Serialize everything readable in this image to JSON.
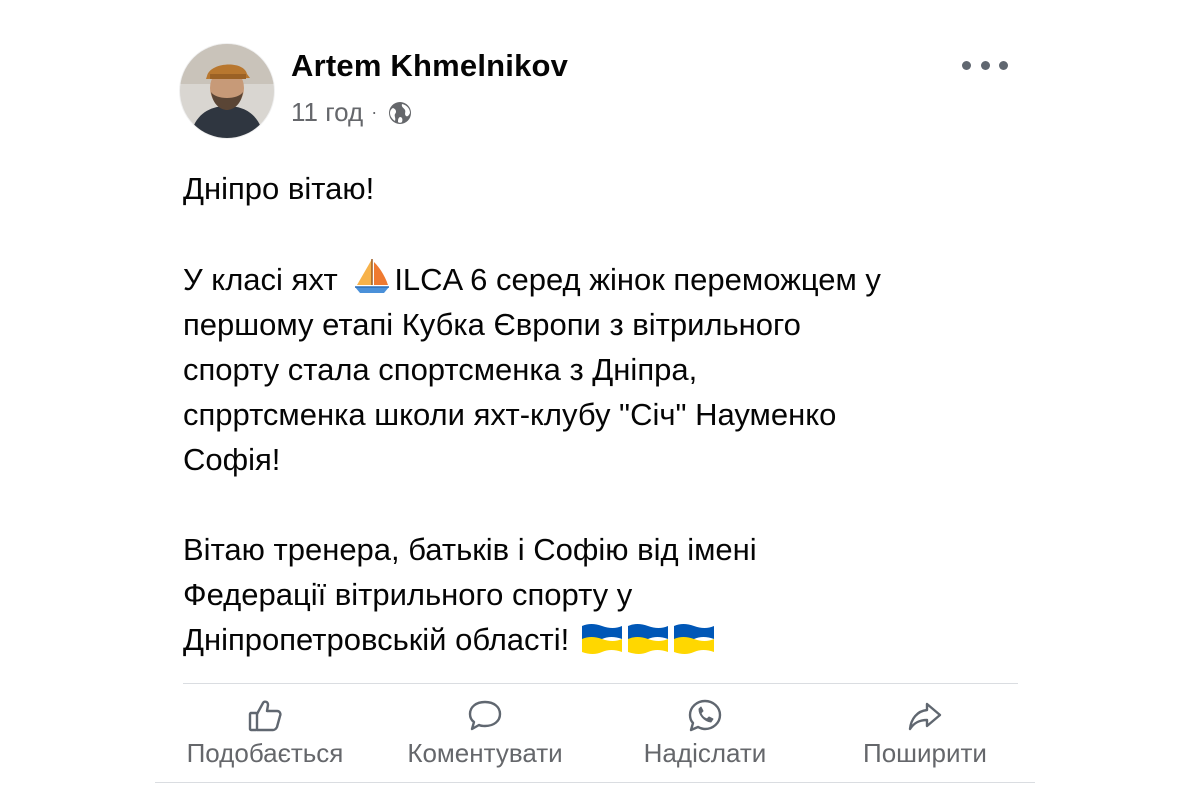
{
  "post": {
    "author": "Artem Khmelnikov",
    "time": "11 год",
    "separator": "·",
    "audience_icon": "globe-icon",
    "more_icon": "more-dots-icon",
    "text": {
      "greeting": "Дніпро вітаю!",
      "p2_line1_a": "У класі яхт",
      "p2_line1_b": "ILCA 6 серед жінок переможцем у",
      "p2_line2": "першому етапі Кубка Європи з вітрильного",
      "p2_line3": "спорту стала спортсменка з Дніпра,",
      "p2_line4": "спрртсменка  школи яхт-клубу \"Січ\" Науменко",
      "p2_line5": "Софія!",
      "p3_line1": "Вітаю тренера, батьків і Софію від імені",
      "p3_line2": "Федерації вітрильного спорту у",
      "p3_line3": "Дніпропетровській області!"
    },
    "emoji": {
      "sailboat": "sailboat-icon",
      "flag": "ukraine-flag-icon",
      "flag_count": 3,
      "flag_colors": [
        "#0057b7",
        "#ffd700"
      ]
    }
  },
  "actions": [
    {
      "label": "Подобається",
      "icon": "like-icon"
    },
    {
      "label": "Коментувати",
      "icon": "comment-icon"
    },
    {
      "label": "Надіслати",
      "icon": "whatsapp-icon"
    },
    {
      "label": "Поширити",
      "icon": "share-icon"
    }
  ],
  "colors": {
    "text": "#050505",
    "secondary": "#65676b",
    "divider": "#dadde1",
    "icon": "#606770"
  }
}
